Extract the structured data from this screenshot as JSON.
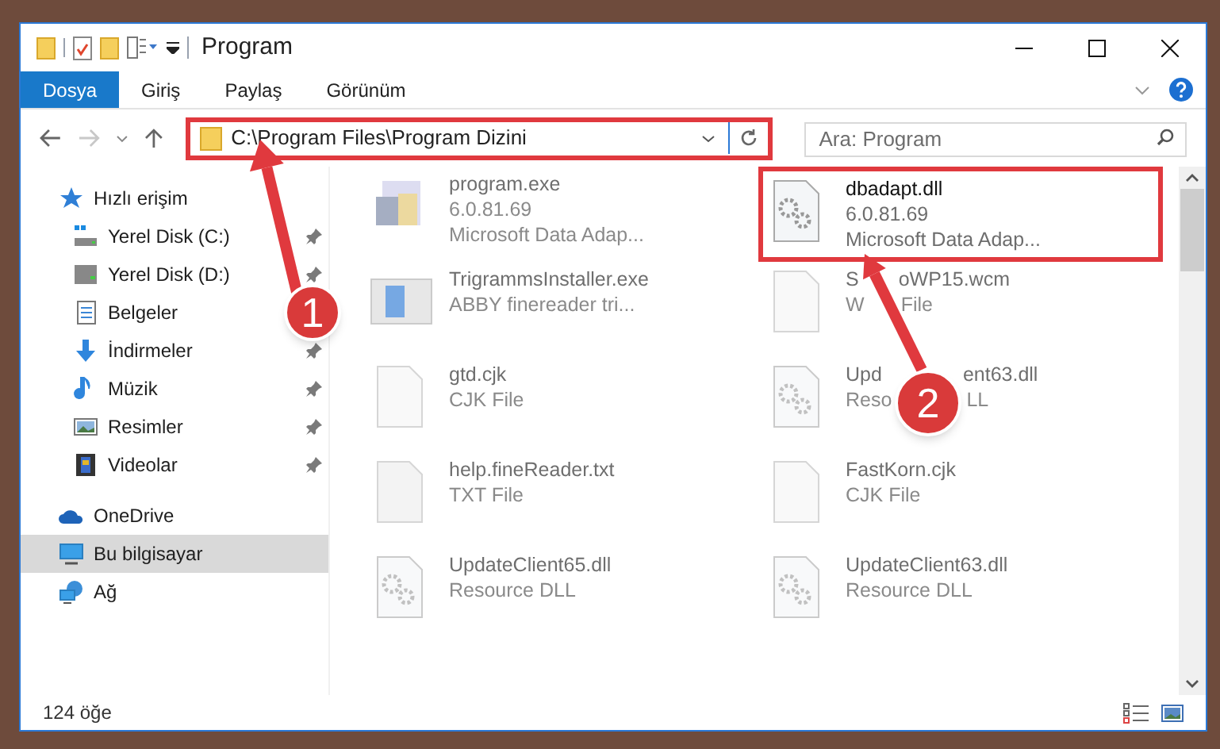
{
  "window": {
    "title": "Program"
  },
  "ribbon_tabs": [
    {
      "label": "Dosya",
      "selected": true
    },
    {
      "label": "Giriş",
      "selected": false
    },
    {
      "label": "Paylaş",
      "selected": false
    },
    {
      "label": "Görünüm",
      "selected": false
    }
  ],
  "address": {
    "path": "C:\\Program Files\\Program Dizini",
    "highlighted": true
  },
  "search": {
    "placeholder": "Ara: Program"
  },
  "sidebar": [
    {
      "label": "Hızlı erişim",
      "kind": "star",
      "selected": false,
      "children": [
        {
          "label": "Yerel Disk (C:)",
          "kind": "drive-c",
          "pinned": true
        },
        {
          "label": "Yerel Disk (D:)",
          "kind": "drive",
          "pinned": true
        },
        {
          "label": "Belgeler",
          "kind": "docs"
        },
        {
          "label": "İndirmeler",
          "kind": "download",
          "pinned": true
        },
        {
          "label": "Müzik",
          "kind": "music",
          "pinned": true
        },
        {
          "label": "Resimler",
          "kind": "pictures",
          "pinned": true
        },
        {
          "label": "Videolar",
          "kind": "videos",
          "pinned": true
        }
      ]
    },
    {
      "label": "OneDrive",
      "kind": "cloud",
      "selected": false
    },
    {
      "label": "Bu bilgisayar",
      "kind": "pc",
      "selected": true
    },
    {
      "label": "Ağ",
      "kind": "network",
      "selected": false
    }
  ],
  "files": [
    {
      "name": [
        "program.exe"
      ],
      "details": [
        [
          "6.0.81.69"
        ],
        [
          "Microsoft Data Adap..."
        ]
      ],
      "kind": "app",
      "blurred": true,
      "highlighted": false
    },
    {
      "name": [
        "dbadapt.dll"
      ],
      "details": [
        [
          "6.0.81.69"
        ],
        [
          "Microsoft Data Adap..."
        ]
      ],
      "kind": "dll",
      "blurred": false,
      "highlighted": true
    },
    {
      "name": [
        "TrigrammsInstaller.exe"
      ],
      "details": [
        [
          "ABBY finereader tri..."
        ]
      ],
      "kind": "installer",
      "blurred": true,
      "highlighted": false
    },
    {
      "name": [
        "S",
        "oWP15.wcm"
      ],
      "details": [
        [
          "W",
          "File"
        ]
      ],
      "kind": "blank",
      "blurred": true,
      "highlighted": false
    },
    {
      "name": [
        "gtd.cjk"
      ],
      "details": [
        [
          "CJK File"
        ]
      ],
      "kind": "blank",
      "blurred": true,
      "highlighted": false
    },
    {
      "name": [
        "Upd",
        "ent63.dll"
      ],
      "details": [
        [
          "Reso",
          "LL"
        ]
      ],
      "kind": "dll",
      "blurred": true,
      "highlighted": false
    },
    {
      "name": [
        "help.fineReader.txt"
      ],
      "details": [
        [
          "TXT File"
        ]
      ],
      "kind": "text",
      "blurred": true,
      "highlighted": false
    },
    {
      "name": [
        "FastKorn.cjk"
      ],
      "details": [
        [
          "CJK File"
        ]
      ],
      "kind": "blank",
      "blurred": true,
      "highlighted": false
    },
    {
      "name": [
        "UpdateClient65.dll"
      ],
      "details": [
        [
          "Resource DLL"
        ]
      ],
      "kind": "dll",
      "blurred": true,
      "highlighted": false
    },
    {
      "name": [
        "UpdateClient63.dll"
      ],
      "details": [
        [
          "Resource DLL"
        ]
      ],
      "kind": "dll",
      "blurred": true,
      "highlighted": false
    }
  ],
  "status_bar": {
    "item_count": "124 öğe"
  },
  "annotations": [
    {
      "label": "1"
    },
    {
      "label": "2"
    }
  ]
}
